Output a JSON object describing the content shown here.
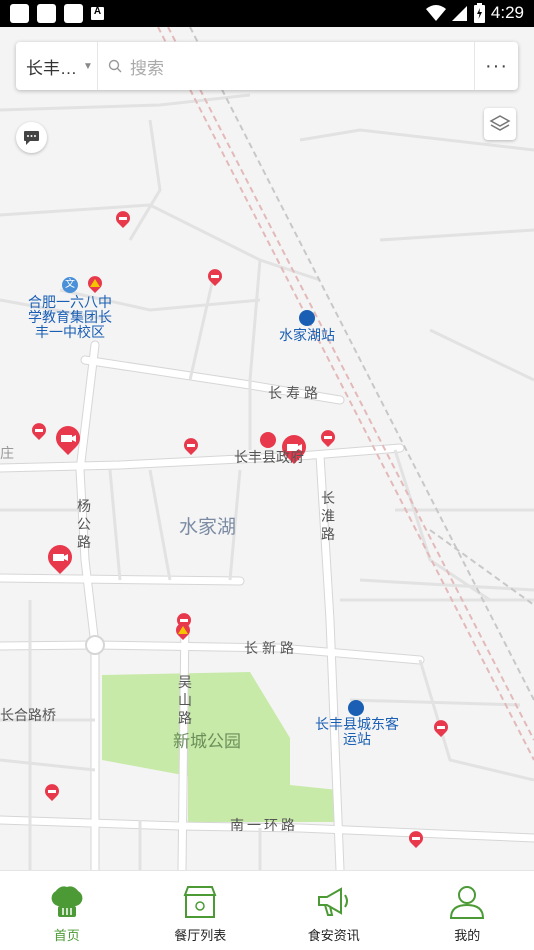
{
  "status_bar": {
    "time": "4:29",
    "notif_letter": "A"
  },
  "search_bar": {
    "city": "长丰…",
    "placeholder": "搜索",
    "more": "···"
  },
  "map": {
    "labels": {
      "school": "合肥一六八中学教育集团长丰一中校区",
      "station": "水家湖站",
      "changshou_road": "长寿路",
      "gov": "长丰县政府",
      "yang_road": "杨公路",
      "changhuai_road": "长淮路",
      "district": "水家湖",
      "changxin_road": "长新路",
      "wushan_road": "吴山路",
      "park": "新城公园",
      "bus_station": "长丰县城东客运站",
      "bridge": "长合路桥",
      "nanyi_road": "南一环路",
      "left_edge": "庄"
    }
  },
  "colors": {
    "accent": "#4c9a36",
    "pin": "#e8384c",
    "park": "#c8eaa8"
  },
  "nav": {
    "items": [
      {
        "label": "首页",
        "icon": "chef-hat-icon"
      },
      {
        "label": "餐厅列表",
        "icon": "store-icon"
      },
      {
        "label": "食安资讯",
        "icon": "megaphone-icon"
      },
      {
        "label": "我的",
        "icon": "user-icon"
      }
    ]
  }
}
